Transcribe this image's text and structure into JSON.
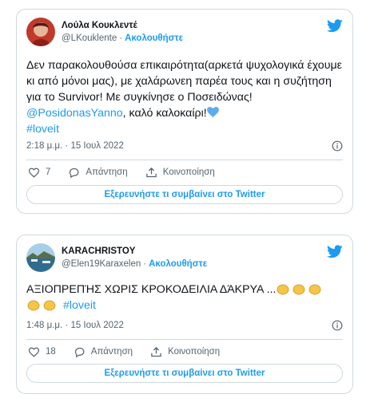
{
  "brand_color": "#1d9bf0",
  "tweets": [
    {
      "author_name": "Λούλα Κουκλεντέ",
      "handle": "@LKouklente",
      "separator": "·",
      "follow_label": "Ακολουθήστε",
      "text_parts": [
        "Δεν παρακολουθούσα επικαιρότητα(αρκετά ψυχολογικά έχουμε κι από μόνοι μας), με χαλάρωνεη παρέα τους και η συζήτηση για το Survivor! Με συγκίνησε ο Ποσειδώνας! ",
        "@PosidonasYanno",
        ", καλό καλοκαίρι!",
        "#loveit"
      ],
      "timestamp": "2:18 μ.μ. · 15 Ιουλ 2022",
      "like_count": "7",
      "reply_label": "Απάντηση",
      "share_label": "Κοινοποίηση",
      "explore_label": "Εξερευνήστε τι συμβαίνει στο Twitter",
      "icons": [
        "heart-emoji",
        "info-icon",
        "twitter-logo"
      ]
    },
    {
      "author_name": "KARACHRISTOY",
      "handle": "@Elen19Karaxelen",
      "separator": "·",
      "follow_label": "Ακολουθήστε",
      "text_parts": [
        "ΑΞΙΟΠΡΕΠΉΣ  ΧΩΡΙΣ ΚΡΟΚΟΔΕΙΛΙΑ ΔΆΚΡΥΑ ...",
        "#loveit"
      ],
      "timestamp": "1:48 μ.μ. · 15 Ιουλ 2022",
      "like_count": "18",
      "reply_label": "Απάντηση",
      "share_label": "Κοινοποίηση",
      "explore_label": "Εξερευνήστε τι συμβαίνει στο Twitter",
      "icons": [
        "clapping-hands-emoji",
        "info-icon",
        "twitter-logo"
      ]
    }
  ]
}
